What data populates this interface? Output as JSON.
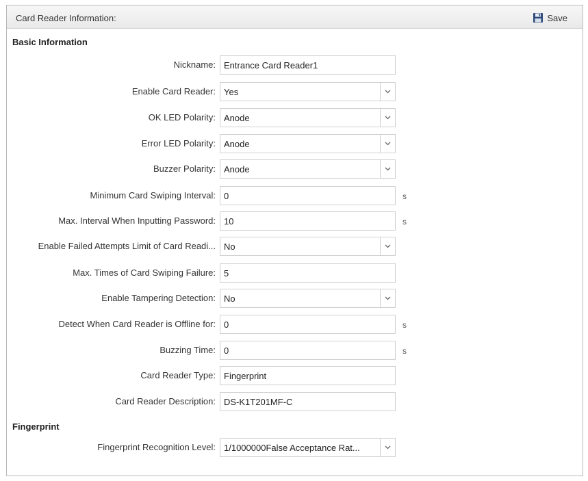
{
  "header": {
    "title": "Card Reader Information:",
    "save_label": "Save"
  },
  "sections": {
    "basic": "Basic Information",
    "fingerprint": "Fingerprint"
  },
  "fields": [
    {
      "label": "Nickname:",
      "value": "Entrance Card Reader1",
      "type": "text",
      "unit": ""
    },
    {
      "label": "Enable Card Reader:",
      "value": "Yes",
      "type": "select",
      "unit": ""
    },
    {
      "label": "OK LED Polarity:",
      "value": "Anode",
      "type": "select",
      "unit": ""
    },
    {
      "label": "Error LED Polarity:",
      "value": "Anode",
      "type": "select",
      "unit": ""
    },
    {
      "label": "Buzzer Polarity:",
      "value": "Anode",
      "type": "select",
      "unit": ""
    },
    {
      "label": "Minimum Card Swiping Interval:",
      "value": "0",
      "type": "text",
      "unit": "s"
    },
    {
      "label": "Max. Interval When Inputting Password:",
      "value": "10",
      "type": "text",
      "unit": "s"
    },
    {
      "label": "Enable Failed Attempts Limit of Card Readi...",
      "value": "No",
      "type": "select",
      "unit": ""
    },
    {
      "label": "Max. Times of Card Swiping Failure:",
      "value": "5",
      "type": "text",
      "unit": ""
    },
    {
      "label": "Enable Tampering Detection:",
      "value": "No",
      "type": "select",
      "unit": ""
    },
    {
      "label": "Detect When Card Reader is Offline for:",
      "value": "0",
      "type": "text",
      "unit": "s"
    },
    {
      "label": "Buzzing Time:",
      "value": "0",
      "type": "text",
      "unit": "s"
    },
    {
      "label": "Card Reader Type:",
      "value": "Fingerprint",
      "type": "text",
      "unit": ""
    },
    {
      "label": "Card Reader Description:",
      "value": "DS-K1T201MF-C",
      "type": "text",
      "unit": ""
    },
    {
      "label": "Fingerprint Recognition Level:",
      "value": "1/1000000False Acceptance Rat...",
      "type": "select",
      "unit": ""
    }
  ],
  "icons": {
    "save": "floppy-disk-icon",
    "dropdown": "chevron-down-icon"
  },
  "colors": {
    "border": "#cfcfcf",
    "header_bg": "#ececec",
    "text": "#333333"
  }
}
